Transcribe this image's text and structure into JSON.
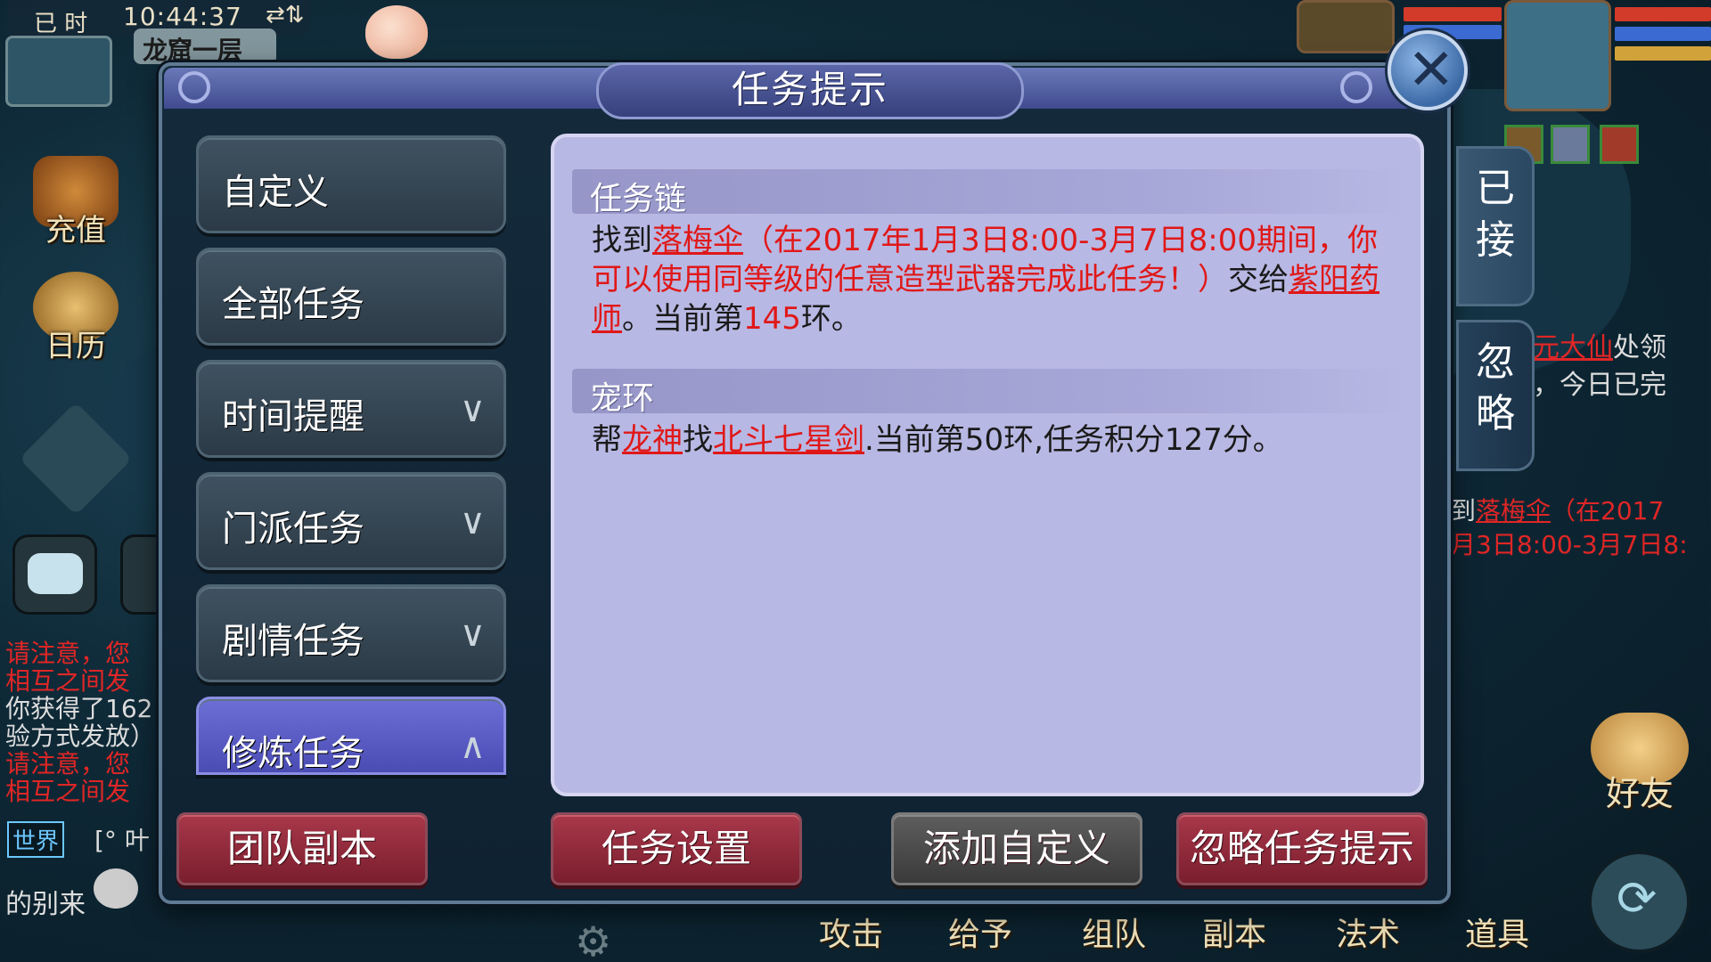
{
  "hud": {
    "status_label": "已 时",
    "time": "10:44:37",
    "net_icons": "⇄⇅",
    "map_name": "龙窟一层",
    "side_icons": [
      {
        "label": "充值",
        "icon": "treasure-icon"
      },
      {
        "label": "日历",
        "icon": "calendar-icon"
      }
    ],
    "chat": {
      "lines": [
        {
          "text": "请注意，您",
          "color": "red"
        },
        {
          "text": "相互之间发",
          "color": "red"
        },
        {
          "text": "你获得了162",
          "color": "white"
        },
        {
          "text": "验方式发放）",
          "color": "white"
        },
        {
          "text": "请注意，您",
          "color": "red"
        },
        {
          "text": "相互之间发",
          "color": "red"
        }
      ],
      "world_tag": "世界",
      "world_msg": "[° 叶",
      "last_msg": "的别来"
    },
    "right_fragment": {
      "line1_red": "元大仙",
      "line1_rest": "处领",
      "line2": "，今日已完"
    },
    "right_fragment2": {
      "line1_pre": "到",
      "line1_red": "落梅伞",
      "line1_rest": "（在2017",
      "line2": "月3日8:00-3月7日8:"
    },
    "friend_label": "好友",
    "bottom_actions": [
      "攻击",
      "给予",
      "组队",
      "副本",
      "法术",
      "道具"
    ]
  },
  "dialog": {
    "title": "任务提示",
    "close_icon": "close-icon",
    "menu": [
      {
        "label": "自定义",
        "has_chevron": false,
        "chevron": ""
      },
      {
        "label": "全部任务",
        "has_chevron": false,
        "chevron": ""
      },
      {
        "label": "时间提醒",
        "has_chevron": true,
        "chevron": "∨"
      },
      {
        "label": "门派任务",
        "has_chevron": true,
        "chevron": "∨"
      },
      {
        "label": "剧情任务",
        "has_chevron": true,
        "chevron": "∨"
      },
      {
        "label": "修炼任务",
        "has_chevron": true,
        "chevron": "∧",
        "active": true
      }
    ],
    "sections": [
      {
        "header": "任务链",
        "p1": "找到",
        "link1": "落梅伞",
        "red1": "（在2017年1月3日8:00-3月7日8:00期间，你可以使用同等级的任意造型武器完成此任务！）",
        "p2": "交给",
        "link2": "紫阳药师",
        "p3": "。当前第",
        "num": "145",
        "p4": "环。"
      },
      {
        "header": "宠环",
        "p1": "帮",
        "link1": "龙神",
        "p2": "找",
        "link2": "北斗七星剑",
        "p3": ".当前第50环,任务积分127分。"
      }
    ],
    "side_tabs": [
      {
        "label1": "已",
        "label2": "接"
      },
      {
        "label1": "忽",
        "label2": "略"
      }
    ],
    "buttons": {
      "team_dungeon": "团队副本",
      "task_settings": "任务设置",
      "add_custom": "添加自定义",
      "ignore_tip": "忽略任务提示"
    }
  },
  "colors": {
    "accent_red": "#e01818",
    "panel_bg": "#b8b8e4",
    "active_tab": "#5b5dc6"
  }
}
